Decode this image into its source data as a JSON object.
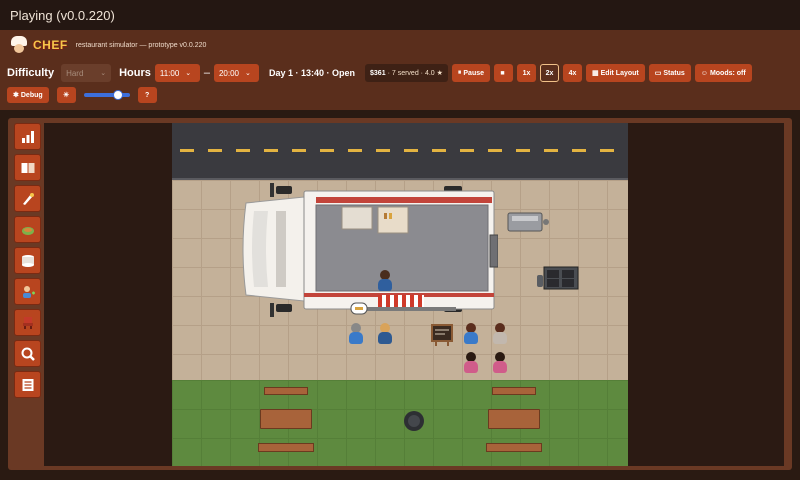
{
  "window": {
    "title": "Playing  (v0.0.220)"
  },
  "app": {
    "logo_text": "CHEF",
    "tagline": "restaurant simulator — prototype v0.0.220"
  },
  "controls": {
    "difficulty_label": "Difficulty",
    "difficulty_value": "Hard",
    "hours_label": "Hours",
    "open_time": "11:00",
    "hours_separator": "–",
    "close_time": "20:00",
    "day_status": "Day 1 · 13:40 · Open",
    "money": "$361",
    "stats_rest": "· 7 served · 4.0 ★",
    "pause_label": "Pause",
    "stop_label": "",
    "speed_1x": "1x",
    "speed_2x": "2x",
    "speed_4x": "4x",
    "active_speed": "2x",
    "edit_layout_label": "Edit Layout",
    "status_label": "Status",
    "moods_label": "Moods: off",
    "debug_label": "Debug",
    "help_label": "?",
    "volume": 0.75
  },
  "sidebar": {
    "items": [
      {
        "icon": "stats-chart-icon"
      },
      {
        "icon": "recipe-book-icon"
      },
      {
        "icon": "ingredient-icon"
      },
      {
        "icon": "food-tray-icon"
      },
      {
        "icon": "storage-barrel-icon"
      },
      {
        "icon": "hire-staff-icon"
      },
      {
        "icon": "furniture-icon"
      },
      {
        "icon": "inspect-magnifier-icon"
      },
      {
        "icon": "menu-list-icon"
      }
    ]
  },
  "colors": {
    "accent": "#b8451f",
    "panel": "#5a2e1c",
    "road": "#3a3a3f",
    "grass": "#5e8a3f",
    "sand": "#c4b199"
  }
}
